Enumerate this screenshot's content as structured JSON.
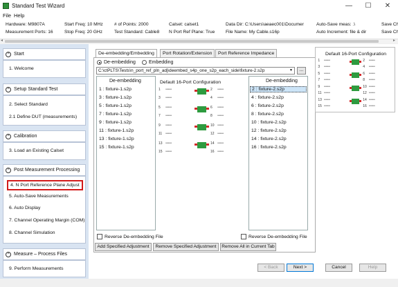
{
  "window": {
    "title": "Standard Test Wizard",
    "min": "—",
    "max": "☐",
    "close": "✕"
  },
  "menu": {
    "file": "File",
    "help": "Help"
  },
  "info": {
    "hardware": "Hardware: M9807A",
    "ports": "Measurement Ports: 16",
    "start_freq": "Start Freq: 10 MHz",
    "stop_freq": "Stop Freq: 20 GHz",
    "points": "# of Points: 2000",
    "standard": "Test Standard: Cable8",
    "calset": "Calset: calset1",
    "ref_plane": "N Port Ref Plane: True",
    "data_dir": "Data Dir: C:\\Users\\aeaec001\\Documer",
    "file_name": "File Name: My Cable.s16p",
    "auto_save": "Auto-Save meas: .\\",
    "auto_inc": "Auto Increment: file & dir",
    "save_ch1": "Save Ch",
    "save_ch2": "Save Ch"
  },
  "sidebar": {
    "sections": [
      {
        "title": "Start",
        "items": [
          "1. Welcome"
        ]
      },
      {
        "title": "Setup Standard Test",
        "items": [
          "2. Select Standard",
          "2.1 Define DUT   (measurements)"
        ]
      },
      {
        "title": "Calibration",
        "items": [
          "3. Load an Existing Calset"
        ]
      },
      {
        "title": "Post Measurement Processing",
        "items": [
          "4. N Port Reference Plane Adjust",
          "5. Auto-Save Measurements",
          "6. Auto Display",
          "7. Channel Operating Margin (COM)",
          "8. Channel Simulation"
        ]
      },
      {
        "title": "Measure – Process Files",
        "items": [
          "9. Perform Measurements"
        ]
      }
    ],
    "collapse_glyph": "^"
  },
  "tabs": [
    "De-embedding/Embedding",
    "Port Rotation/Extension",
    "Port Reference Impedance"
  ],
  "mode": {
    "deembed": "De-embedding",
    "embed": "Embedding"
  },
  "path": {
    "value": "C:\\ctPLTS\\Tests\\n_port_ref_pln_adj\\deembed_s4p_one_s2p_each_side\\fixture-2.s2p",
    "browse": "..."
  },
  "left_list": {
    "title": "De-embedding",
    "rows": [
      "1  : fixture-1.s2p",
      "3  : fixture-1.s2p",
      "5  : fixture-1.s2p",
      "7  : fixture-1.s2p",
      "9  : fixture-1.s2p",
      "11 : fixture-1.s2p",
      "13 : fixture-1.s2p",
      "15 : fixture-1.s2p"
    ]
  },
  "config": {
    "title": "Default 16-Port Configuration",
    "left_ports": [
      "1",
      "3",
      "5",
      "7",
      "9",
      "11",
      "13",
      "15"
    ],
    "right_ports": [
      "2",
      "4",
      "6",
      "8",
      "10",
      "12",
      "14",
      "16"
    ],
    "dots": "•••••••",
    "colors": {
      "green": "#2e9b3f",
      "red": "#d22a2a"
    }
  },
  "right_list": {
    "title": "De-embedding",
    "rows": [
      "2  : fixture-2.s2p",
      "4  : fixture-2.s2p",
      "6  : fixture-2.s2p",
      "8  : fixture-2.s2p",
      "10 : fixture-2.s2p",
      "12 : fixture-2.s2p",
      "14 : fixture-2.s2p",
      "16 : fixture-2.s2p"
    ]
  },
  "reverse_left": "Reverse De-embedding File",
  "reverse_right": "Reverse De-embedding File",
  "actions": {
    "add": "Add Specified Adjustment",
    "remove": "Remove Specified Adjustment",
    "remove_all": "Remove All in Current Tab"
  },
  "nav": {
    "back": "< Back",
    "next": "Next >",
    "cancel": "Cancel",
    "help": "Help"
  },
  "right_panel": {
    "title": "Default 16-Port Configuration"
  }
}
